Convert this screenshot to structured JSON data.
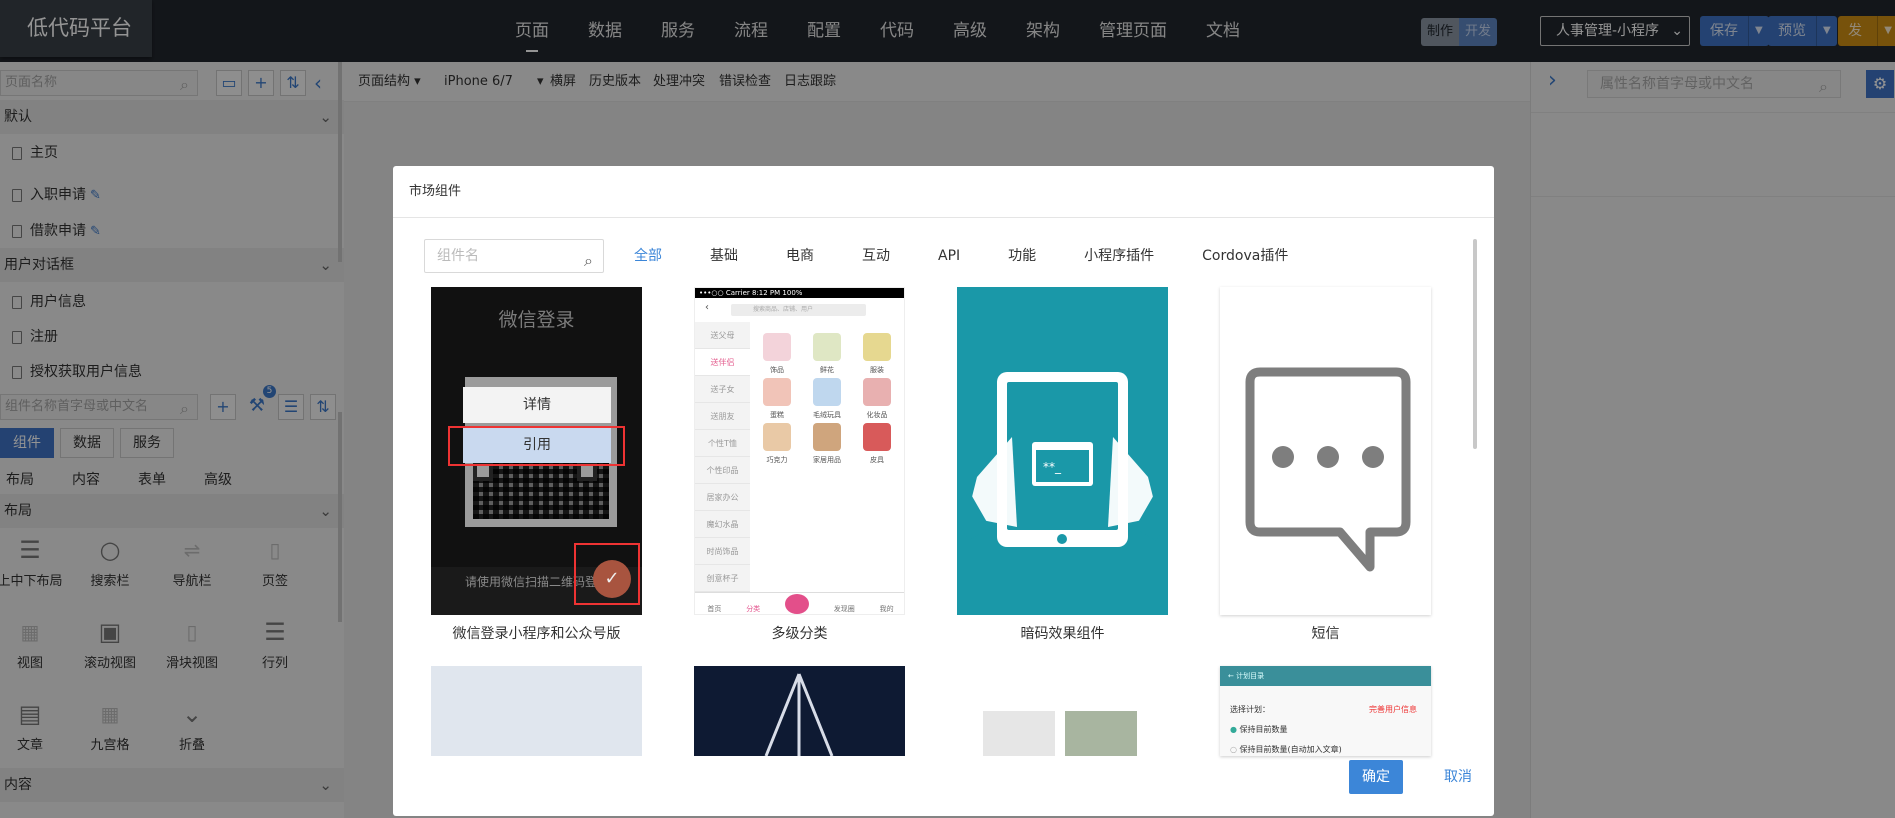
{
  "logo": "低代码平台",
  "nav": [
    "页面",
    "数据",
    "服务",
    "流程",
    "配置",
    "代码",
    "高级",
    "架构",
    "管理页面",
    "文档"
  ],
  "mode": {
    "a": "制作",
    "b": "开发"
  },
  "project_select": "人事管理-小程序",
  "actions": {
    "save": "保存",
    "preview": "预览",
    "publish": "发布"
  },
  "left": {
    "page_search_placeholder": "页面名称",
    "groups": [
      {
        "title": "默认",
        "pages": [
          "主页",
          "入职申请",
          "借款申请"
        ]
      },
      {
        "title": "用户对话框",
        "pages": [
          "用户信息",
          "注册",
          "授权获取用户信息"
        ]
      }
    ],
    "component_search_placeholder": "组件名称首字母或中文名",
    "badge": "5",
    "tabs": [
      "组件",
      "数据",
      "服务"
    ],
    "subtabs": [
      "布局",
      "内容",
      "表单",
      "高级"
    ],
    "layout_section": "布局",
    "content_section": "内容",
    "components": [
      "上中下布局",
      "搜索栏",
      "导航栏",
      "页签",
      "视图",
      "滚动视图",
      "滑块视图",
      "行列",
      "文章",
      "九宫格",
      "折叠"
    ]
  },
  "center_toolbar": {
    "structure": "页面结构",
    "device": "iPhone 6/7",
    "items": [
      "横屏",
      "历史版本",
      "处理冲突",
      "错误检查",
      "日志跟踪"
    ]
  },
  "right": {
    "prop_search_placeholder": "属性名称首字母或中文名"
  },
  "modal": {
    "title": "市场组件",
    "search_placeholder": "组件名",
    "categories": [
      "全部",
      "基础",
      "电商",
      "互动",
      "API",
      "功能",
      "小程序插件",
      "Cordova插件"
    ],
    "cards": [
      {
        "caption": "微信登录小程序和公众号版",
        "thumb_title": "微信登录",
        "thumb_hint": "请使用微信扫描二维码登",
        "detail": "详情",
        "use": "引用"
      },
      {
        "caption": "多级分类"
      },
      {
        "caption": "暗码效果组件"
      },
      {
        "caption": "短信"
      }
    ],
    "card2": {
      "status": "•••○○ Carrier  8:12 PM  100%",
      "search": "搜索商品、店铺、用户",
      "side": [
        "送父母",
        "送伴侣",
        "送子女",
        "送朋友",
        "个性T恤",
        "个性印品",
        "居家办公",
        "魔幻水晶",
        "时尚饰品",
        "创意杯子"
      ],
      "items": [
        "饰品",
        "鲜花",
        "服装",
        "蛋糕",
        "毛绒玩具",
        "化妆品",
        "巧克力",
        "家居用品",
        "皮具"
      ],
      "tabbar": [
        "首页",
        "分类",
        "",
        "发现圈",
        "我的"
      ]
    },
    "card8": {
      "bar": "←  计划目录",
      "select": "选择计划：",
      "red": "完善用户信息",
      "row1": "保持目前数量",
      "row2": "保持目前数量(自动加入文章)"
    },
    "ok": "确定",
    "cancel": "取消"
  }
}
